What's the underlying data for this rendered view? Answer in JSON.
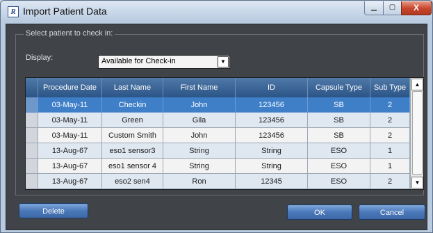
{
  "window": {
    "title": "Import Patient Data",
    "icon_letter": "R"
  },
  "caption_buttons": {
    "minimize": "▁",
    "maximize": "▢",
    "close": "X"
  },
  "group": {
    "legend": "Select patient to check in:"
  },
  "display": {
    "label": "Display:",
    "selected": "Available for Check-in"
  },
  "table": {
    "columns": [
      "Procedure Date",
      "Last Name",
      "First Name",
      "ID",
      "Capsule Type",
      "Sub Type"
    ],
    "rows": [
      [
        "03-May-11",
        "Checkin",
        "John",
        "123456",
        "SB",
        "2"
      ],
      [
        "03-May-11",
        "Green",
        "Gila",
        "123456",
        "SB",
        "2"
      ],
      [
        "03-May-11",
        "Custom Smith",
        "John",
        "123456",
        "SB",
        "2"
      ],
      [
        "13-Aug-67",
        "eso1 sensor3",
        "String",
        "String",
        "ESO",
        "1"
      ],
      [
        "13-Aug-67",
        "eso1 sensor 4",
        "String",
        "String",
        "ESO",
        "1"
      ],
      [
        "13-Aug-67",
        "eso2 sen4",
        "Ron",
        "12345",
        "ESO",
        "2"
      ]
    ],
    "selected_row": 0
  },
  "buttons": {
    "delete": "Delete",
    "ok": "OK",
    "cancel": "Cancel"
  }
}
